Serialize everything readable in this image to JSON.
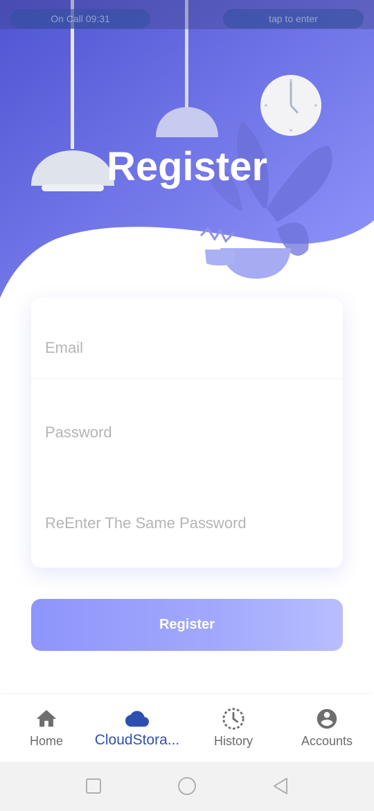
{
  "status_bar": {
    "call_text": "On Call  09:31",
    "tap_text": "tap to enter"
  },
  "header": {
    "title": "Register"
  },
  "form": {
    "email_placeholder": "Email",
    "password_placeholder": "Password",
    "repassword_placeholder": "ReEnter The Same Password"
  },
  "actions": {
    "register_label": "Register"
  },
  "bottom_nav": {
    "items": [
      {
        "label": "Home",
        "icon": "home-icon"
      },
      {
        "label": "CloudStora...",
        "icon": "cloud-icon",
        "active": true
      },
      {
        "label": "History",
        "icon": "history-icon"
      },
      {
        "label": "Accounts",
        "icon": "account-circle-icon"
      }
    ]
  },
  "colors": {
    "header_gradient_start": "#5157d6",
    "header_gradient_end": "#8e93fb",
    "accent": "#2f4fb0",
    "button_gradient_start": "#8e95fb",
    "button_gradient_end": "#b8befe"
  }
}
